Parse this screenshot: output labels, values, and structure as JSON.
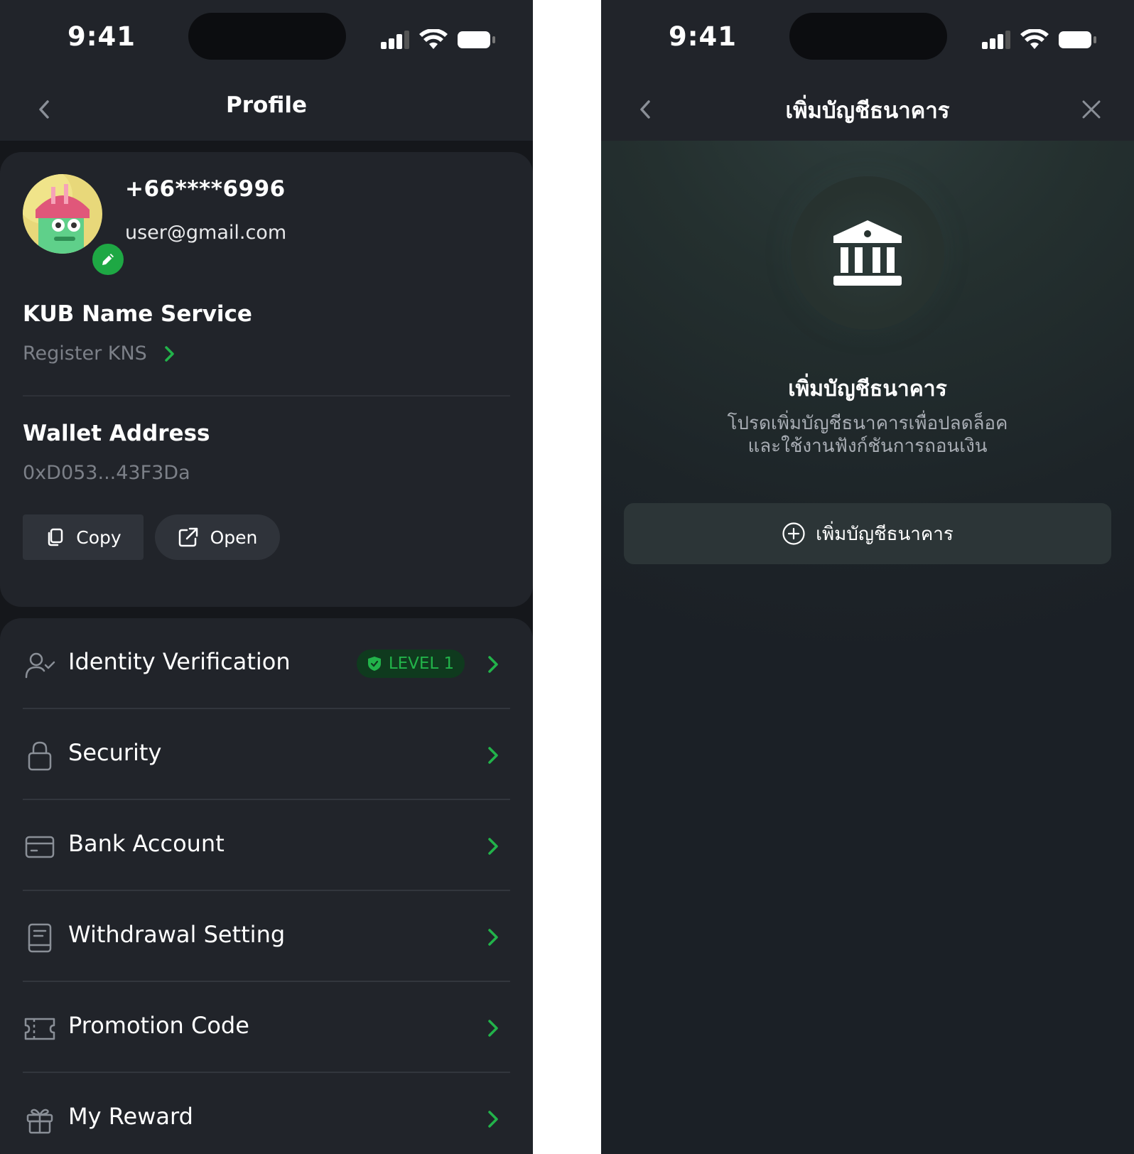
{
  "colors": {
    "accent": "#22b34a",
    "background": "#15171b",
    "card": "#21242a",
    "muted_text": "#7c8088"
  },
  "left": {
    "status": {
      "time": "9:41"
    },
    "nav": {
      "title": "Profile",
      "back_icon": "chevron-left-icon"
    },
    "profile": {
      "phone": "+66****6996",
      "email": "user@gmail.com",
      "avatar_edit_icon": "pencil-icon"
    },
    "kns": {
      "title": "KUB Name Service",
      "link": "Register KNS"
    },
    "wallet": {
      "title": "Wallet Address",
      "address": "0xD053...43F3Da",
      "copy_label": "Copy",
      "open_label": "Open"
    },
    "menu": [
      {
        "label": "Identity Verification",
        "icon": "user-check-icon",
        "badge": "LEVEL 1"
      },
      {
        "label": "Security",
        "icon": "lock-icon"
      },
      {
        "label": "Bank Account",
        "icon": "card-icon"
      },
      {
        "label": "Withdrawal Setting",
        "icon": "book-icon"
      },
      {
        "label": "Promotion Code",
        "icon": "ticket-icon"
      },
      {
        "label": "My Reward",
        "icon": "gift-icon"
      }
    ]
  },
  "right": {
    "status": {
      "time": "9:41"
    },
    "nav": {
      "title": "เพิ่มบัญชีธนาคาร",
      "back_icon": "chevron-left-icon",
      "close_icon": "close-icon"
    },
    "empty_state": {
      "icon": "bank-icon",
      "title": "เพิ่มบัญชีธนาคาร",
      "line1": "โปรดเพิ่มบัญชีธนาคารเพื่อปลดล็อค",
      "line2": "และใช้งานฟังก์ชันการถอนเงิน",
      "button_label": "เพิ่มบัญชีธนาคาร"
    }
  }
}
